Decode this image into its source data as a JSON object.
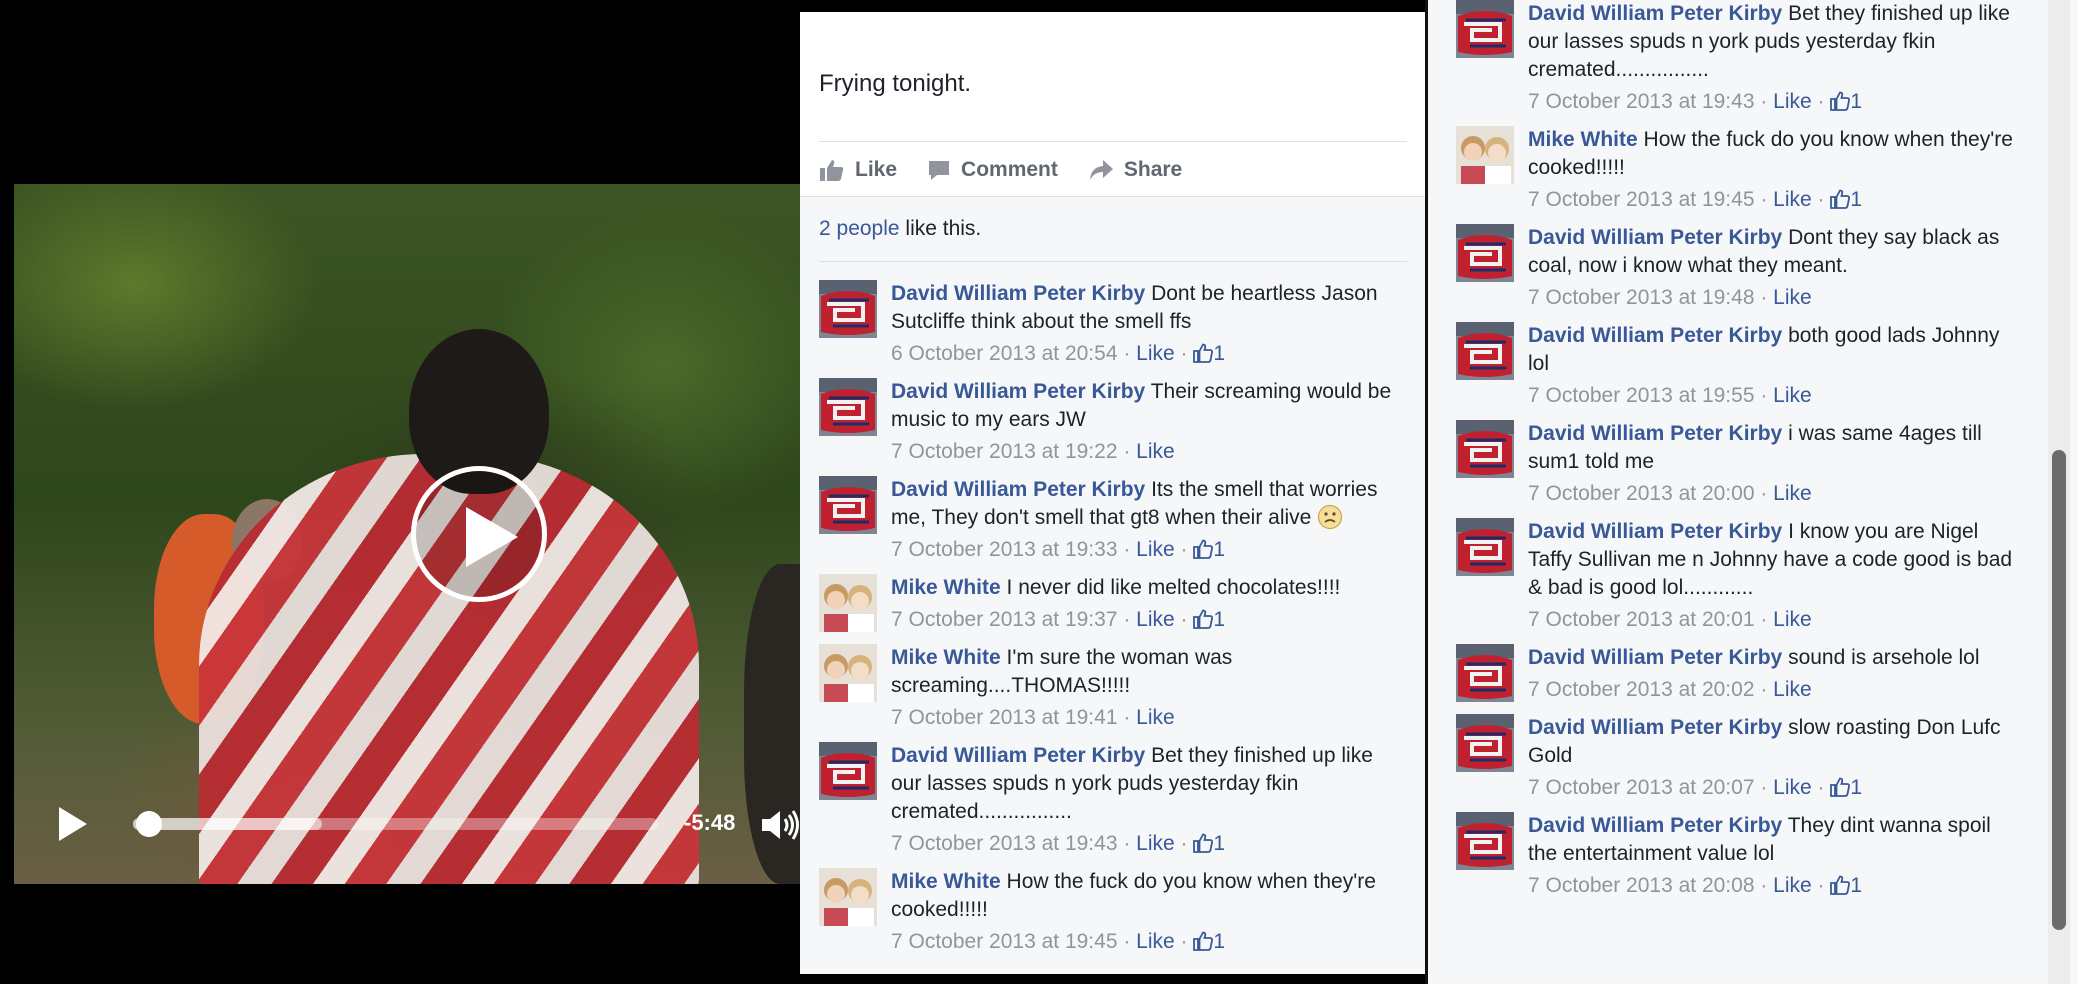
{
  "video": {
    "time_remaining": "-5:48",
    "progress": 0.03,
    "buffered": 0.36
  },
  "post": {
    "text": "Frying tonight.",
    "actions": [
      {
        "label": "Like",
        "icon": "thumbs-up-icon"
      },
      {
        "label": "Comment",
        "icon": "comment-icon"
      },
      {
        "label": "Share",
        "icon": "share-icon"
      }
    ],
    "likes_count_link": "2 people",
    "likes_suffix": " like this."
  },
  "middle_comments": [
    {
      "author": "David William Peter Kirby",
      "text": "Dont be heartless Jason Sutcliffe think about the smell ffs",
      "time": "6 October 2013 at 20:54",
      "like": "Like",
      "likes": "1",
      "avatar": "dwpk"
    },
    {
      "author": "David William Peter Kirby",
      "text": "Their screaming would be music to my ears JW",
      "time": "7 October 2013 at 19:22",
      "like": "Like",
      "likes": "",
      "avatar": "dwpk"
    },
    {
      "author": "David William Peter Kirby",
      "text": "Its the smell that worries me, They don't smell that gt8 when their alive",
      "time": "7 October 2013 at 19:33",
      "like": "Like",
      "likes": "1",
      "avatar": "dwpk",
      "emoji": "frown"
    },
    {
      "author": "Mike White",
      "text": "I never did like melted chocolates!!!!",
      "time": "7 October 2013 at 19:37",
      "like": "Like",
      "likes": "1",
      "avatar": "mw"
    },
    {
      "author": "Mike White",
      "text": "I'm sure the woman was screaming....THOMAS!!!!!",
      "time": "7 October 2013 at 19:41",
      "like": "Like",
      "likes": "",
      "avatar": "mw"
    },
    {
      "author": "David William Peter Kirby",
      "text": "Bet they finished up like our lasses spuds n york puds yesterday fkin cremated................",
      "time": "7 October 2013 at 19:43",
      "like": "Like",
      "likes": "1",
      "avatar": "dwpk"
    },
    {
      "author": "Mike White",
      "text": "How the fuck do you know when they're cooked!!!!!",
      "time": "7 October 2013 at 19:45",
      "like": "Like",
      "likes": "1",
      "avatar": "mw"
    }
  ],
  "right_comments": [
    {
      "author": "David William Peter Kirby",
      "text": "Bet they finished up like our lasses spuds n york puds yesterday fkin cremated................",
      "time": "7 October 2013 at 19:43",
      "like": "Like",
      "likes": "1",
      "avatar": "dwpk"
    },
    {
      "author": "Mike White",
      "text": "How the fuck do you know when they're cooked!!!!!",
      "time": "7 October 2013 at 19:45",
      "like": "Like",
      "likes": "1",
      "avatar": "mw"
    },
    {
      "author": "David William Peter Kirby",
      "text": "Dont they say black as coal, now i know what they meant.",
      "time": "7 October 2013 at 19:48",
      "like": "Like",
      "likes": "",
      "avatar": "dwpk"
    },
    {
      "author": "David William Peter Kirby",
      "text": "both good lads Johnny lol",
      "time": "7 October 2013 at 19:55",
      "like": "Like",
      "likes": "",
      "avatar": "dwpk"
    },
    {
      "author": "David William Peter Kirby",
      "text": "i was same 4ages till sum1 told me",
      "time": "7 October 2013 at 20:00",
      "like": "Like",
      "likes": "",
      "avatar": "dwpk"
    },
    {
      "author": "David William Peter Kirby",
      "text": "I know you are Nigel Taffy Sullivan me n Johnny have a code good is bad & bad is good lol............",
      "time": "7 October 2013 at 20:01",
      "like": "Like",
      "likes": "",
      "avatar": "dwpk"
    },
    {
      "author": "David William Peter Kirby",
      "text": "sound is arsehole lol",
      "time": "7 October 2013 at 20:02",
      "like": "Like",
      "likes": "",
      "avatar": "dwpk"
    },
    {
      "author": "David William Peter Kirby",
      "text": "slow roasting Don Lufc Gold",
      "time": "7 October 2013 at 20:07",
      "like": "Like",
      "likes": "1",
      "avatar": "dwpk"
    },
    {
      "author": "David William Peter Kirby",
      "text": "They dint wanna spoil the entertainment value lol",
      "time": "7 October 2013 at 20:08",
      "like": "Like",
      "likes": "1",
      "avatar": "dwpk"
    }
  ],
  "colors": {
    "link": "#385898",
    "meta": "#90949c",
    "panel_bg": "#f6f7f9"
  }
}
